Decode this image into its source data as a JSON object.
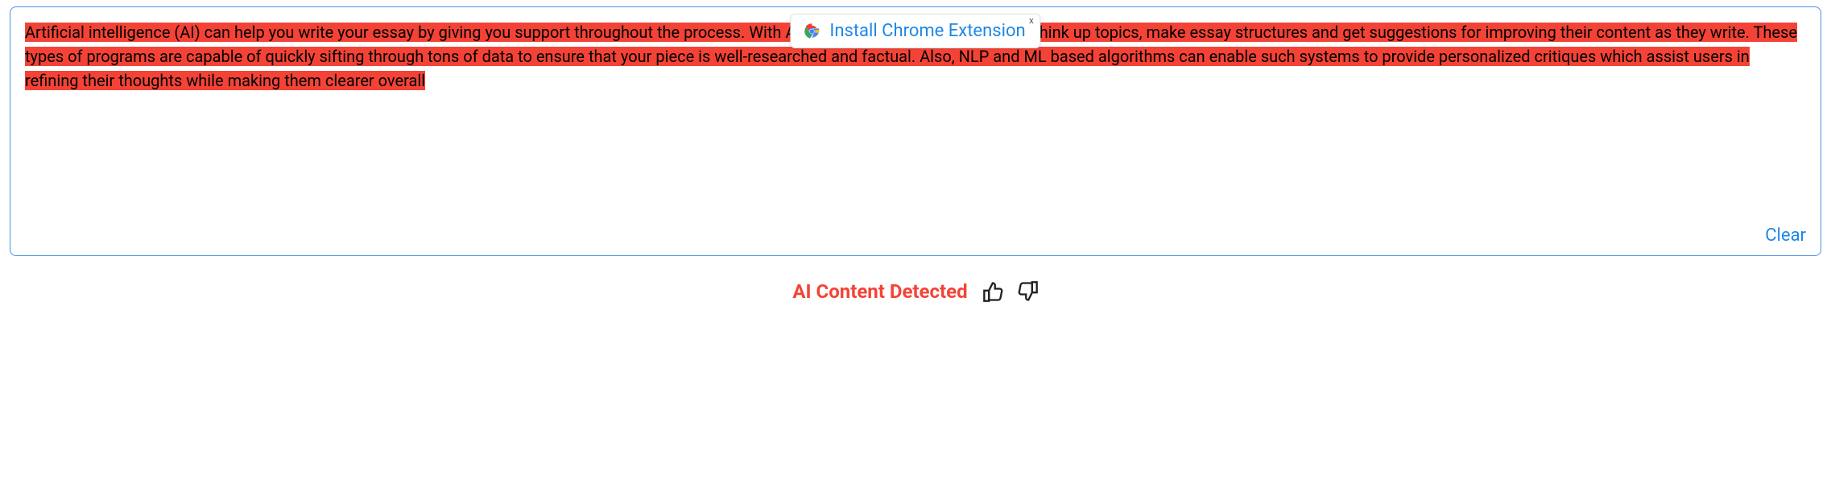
{
  "textarea": {
    "highlighted_content": "Artificial intelligence (AI) can help you write your essay by giving you support throughout the process. With AI-driven writing aids, learners can think up topics, make essay structures and get suggestions for improving their content as they write. These types of programs are capable of quickly sifting through tons of data to ensure that your piece is well-researched and factual. Also, NLP and ML based algorithms can enable such systems to provide personalized critiques which assist users in refining their thoughts while making them clearer overall",
    "clear_label": "Clear"
  },
  "extension_prompt": {
    "label": "Install Chrome Extension",
    "close_symbol": "x"
  },
  "result": {
    "status_text": "AI Content Detected"
  }
}
